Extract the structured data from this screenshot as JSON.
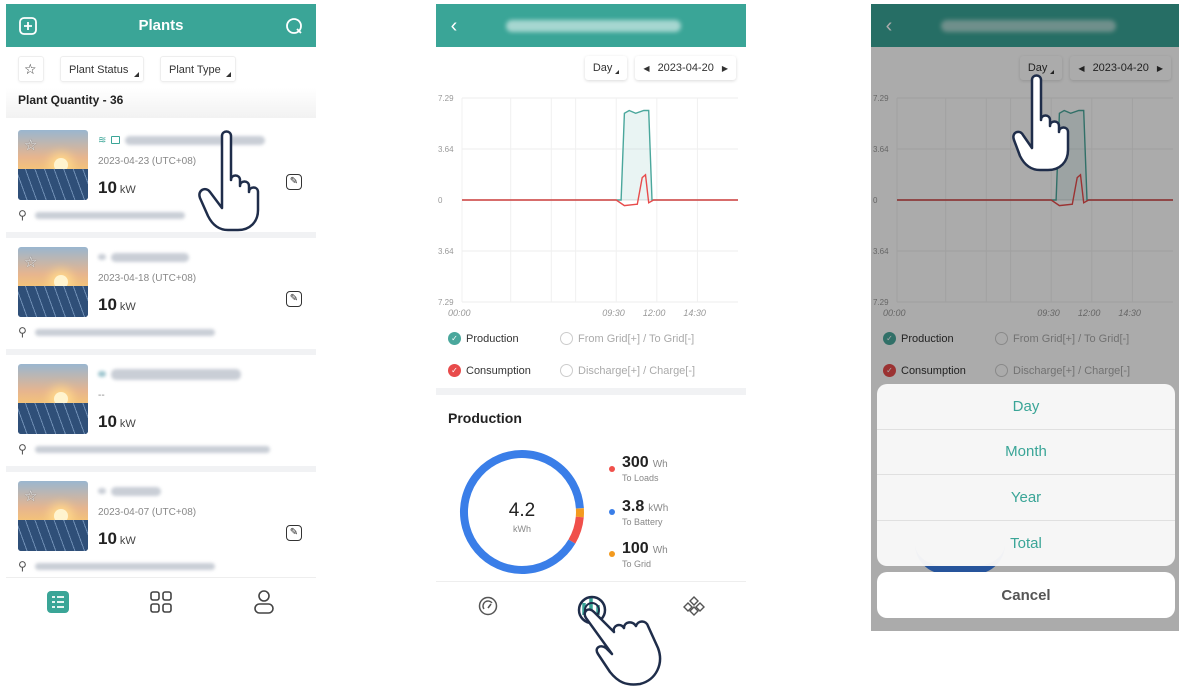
{
  "screen1": {
    "title": "Plants",
    "filters": {
      "plant_status": "Plant Status",
      "plant_type": "Plant Type"
    },
    "quantity_label": "Plant Quantity - 36",
    "plants": [
      {
        "date": "2023-04-23 (UTC+08)",
        "power": "10",
        "unit": "kW"
      },
      {
        "date": "2023-04-18 (UTC+08)",
        "power": "10",
        "unit": "kW"
      },
      {
        "date": "--",
        "power": "10",
        "unit": "kW"
      },
      {
        "date": "2023-04-07 (UTC+08)",
        "power": "10",
        "unit": "kW"
      }
    ]
  },
  "screen2": {
    "period": "Day",
    "date": "2023-04-20",
    "legend": {
      "production": "Production",
      "grid": "From Grid[+] / To Grid[-]",
      "consumption": "Consumption",
      "battery": "Discharge[+] / Charge[-]"
    },
    "section_title": "Production",
    "total": "4.2",
    "total_unit": "kWh",
    "stats": [
      {
        "value": "300",
        "unit": "Wh",
        "label": "To Loads",
        "color": "#f0504b"
      },
      {
        "value": "3.8",
        "unit": "kWh",
        "label": "To Battery",
        "color": "#3a7ee8"
      },
      {
        "value": "100",
        "unit": "Wh",
        "label": "To Grid",
        "color": "#f39a1e"
      }
    ]
  },
  "screen3": {
    "period": "Day",
    "date": "2023-04-20",
    "legend": {
      "production": "Production",
      "grid": "From Grid[+] / To Grid[-]",
      "consumption": "Consumption",
      "battery": "Discharge[+] / Charge[-]"
    },
    "options": [
      "Day",
      "Month",
      "Year",
      "Total"
    ],
    "cancel": "Cancel"
  },
  "chart_data": {
    "type": "line",
    "x_ticks": [
      "00:00",
      "09:30",
      "12:00",
      "14:30"
    ],
    "y_ticks": [
      "7.29",
      "3.64",
      "0",
      "3.64",
      "7.29"
    ],
    "ylim": [
      -7.29,
      7.29
    ],
    "series": [
      {
        "name": "Production",
        "color": "#4aa79c",
        "points": [
          [
            0,
            0
          ],
          [
            9.5,
            0
          ],
          [
            9.8,
            0
          ],
          [
            10.0,
            6.2
          ],
          [
            10.3,
            6.4
          ],
          [
            10.7,
            6.2
          ],
          [
            11.2,
            6.4
          ],
          [
            11.5,
            6.4
          ],
          [
            11.7,
            0
          ],
          [
            12.0,
            0
          ],
          [
            24,
            0
          ]
        ]
      },
      {
        "name": "Consumption",
        "color": "#e84b4b",
        "points": [
          [
            0,
            0
          ],
          [
            9.5,
            0
          ],
          [
            10.0,
            -0.4
          ],
          [
            10.8,
            -0.3
          ],
          [
            11.1,
            1.6
          ],
          [
            11.3,
            1.8
          ],
          [
            11.5,
            -0.2
          ],
          [
            11.8,
            0
          ],
          [
            24,
            0
          ]
        ]
      }
    ],
    "donut": {
      "total": 4.2,
      "unit": "kWh",
      "segments": [
        {
          "label": "To Loads",
          "value": 0.3,
          "color": "#f0504b"
        },
        {
          "label": "To Battery",
          "value": 3.8,
          "color": "#3a7ee8"
        },
        {
          "label": "To Grid",
          "value": 0.1,
          "color": "#f39a1e"
        }
      ]
    }
  }
}
